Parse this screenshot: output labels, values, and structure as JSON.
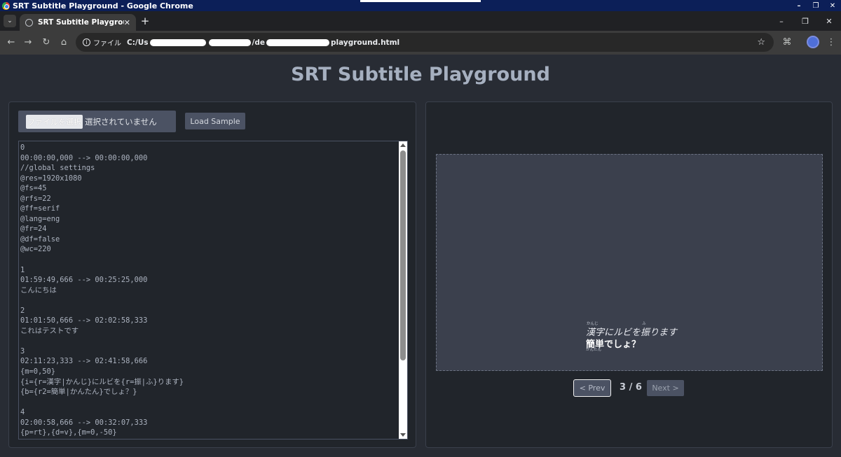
{
  "os_window": {
    "title": "SRT Subtitle Playground - Google Chrome",
    "controls": [
      "–",
      "❐",
      "✕"
    ]
  },
  "browser": {
    "tab_title": "SRT Subtitle Playground",
    "tab_close": "✕",
    "new_tab": "+",
    "menu": "⌄",
    "back": "←",
    "forward": "→",
    "reload": "↻",
    "home": "⌂",
    "star": "☆",
    "extensions": "⌘",
    "more": "⋮",
    "url_chip": "ファイル",
    "url_prefix": "C:/Us",
    "url_mid": "/de",
    "url_suffix": "playground.html",
    "win_controls": [
      "–",
      "❐",
      "✕"
    ]
  },
  "page": {
    "title": "SRT Subtitle Playground",
    "file_input": {
      "button": "ファイルを選択",
      "status": "選択されていません"
    },
    "load_sample": "Load Sample",
    "editor_text": "0\n00:00:00,000 --> 00:00:00,000\n//global settings\n@res=1920x1080\n@fs=45\n@rfs=22\n@ff=serif\n@lang=eng\n@fr=24\n@df=false\n@wc=220\n\n1\n01:59:49,666 --> 00:25:25,000\nこんにちは\n\n2\n01:01:50,666 --> 02:02:58,333\nこれはテストです\n\n3\n02:11:23,333 --> 02:41:58,666\n{m=0,50}\n{i={r=漢字|かんじ}にルビを{r=振|ふ}ります}\n{b={r2=簡単|かんたん}でしょ？}\n\n4\n02:00:58,666 --> 00:32:07,333\n{p=rt},{d=v},{m=0,-50}",
    "preview": {
      "line1": "漢字にルビを振ります",
      "line2": "簡単でしょ？",
      "ruby1": "かんじ",
      "ruby2": "ふ",
      "ruby3": "かんたん"
    },
    "pager": {
      "prev": "< Prev",
      "count": "3 / 6",
      "next": "Next >"
    }
  }
}
